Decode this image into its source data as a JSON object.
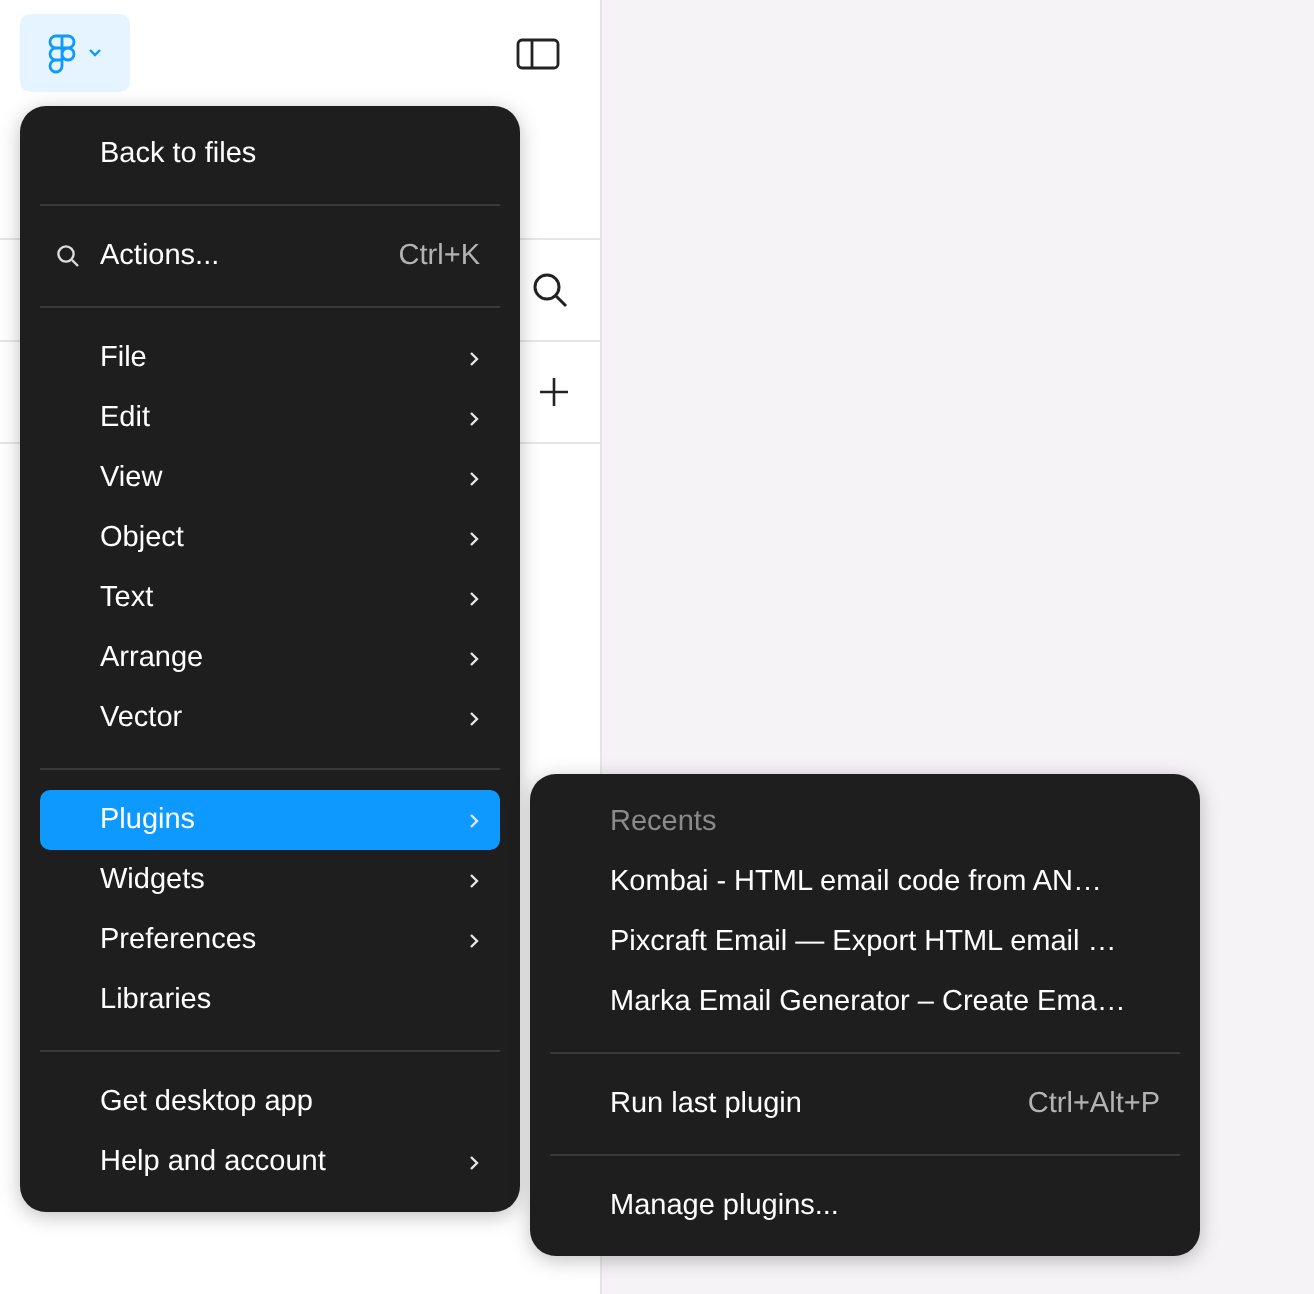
{
  "toolbar": {
    "menu_button": {
      "expanded": true
    }
  },
  "main_menu": {
    "sections": [
      {
        "items": [
          {
            "kind": "item",
            "label": "Back to files",
            "submenu": false,
            "selected": false
          }
        ]
      },
      {
        "items": [
          {
            "kind": "search",
            "label": "Actions...",
            "shortcut": "Ctrl+K",
            "submenu": false,
            "selected": false
          }
        ]
      },
      {
        "items": [
          {
            "kind": "item",
            "label": "File",
            "submenu": true,
            "selected": false
          },
          {
            "kind": "item",
            "label": "Edit",
            "submenu": true,
            "selected": false
          },
          {
            "kind": "item",
            "label": "View",
            "submenu": true,
            "selected": false
          },
          {
            "kind": "item",
            "label": "Object",
            "submenu": true,
            "selected": false
          },
          {
            "kind": "item",
            "label": "Text",
            "submenu": true,
            "selected": false
          },
          {
            "kind": "item",
            "label": "Arrange",
            "submenu": true,
            "selected": false
          },
          {
            "kind": "item",
            "label": "Vector",
            "submenu": true,
            "selected": false
          }
        ]
      },
      {
        "items": [
          {
            "kind": "item",
            "label": "Plugins",
            "submenu": true,
            "selected": true
          },
          {
            "kind": "item",
            "label": "Widgets",
            "submenu": true,
            "selected": false
          },
          {
            "kind": "item",
            "label": "Preferences",
            "submenu": true,
            "selected": false
          },
          {
            "kind": "item",
            "label": "Libraries",
            "submenu": false,
            "selected": false
          }
        ]
      },
      {
        "items": [
          {
            "kind": "item",
            "label": "Get desktop app",
            "submenu": false,
            "selected": false
          },
          {
            "kind": "item",
            "label": "Help and account",
            "submenu": true,
            "selected": false
          }
        ]
      }
    ]
  },
  "plugins_submenu": {
    "sections": [
      {
        "items": [
          {
            "kind": "header",
            "label": "Recents"
          },
          {
            "kind": "item",
            "label": "Kombai - HTML email code from AN…",
            "submenu": false,
            "selected": false
          },
          {
            "kind": "item",
            "label": "Pixcraft Email — Export HTML email …",
            "submenu": false,
            "selected": false
          },
          {
            "kind": "item",
            "label": "Marka Email Generator – Create Ema…",
            "submenu": false,
            "selected": false
          }
        ]
      },
      {
        "items": [
          {
            "kind": "item",
            "label": "Run last plugin",
            "shortcut": "Ctrl+Alt+P",
            "submenu": false,
            "selected": false
          }
        ]
      },
      {
        "items": [
          {
            "kind": "item",
            "label": "Manage plugins...",
            "submenu": false,
            "selected": false
          }
        ]
      }
    ]
  }
}
